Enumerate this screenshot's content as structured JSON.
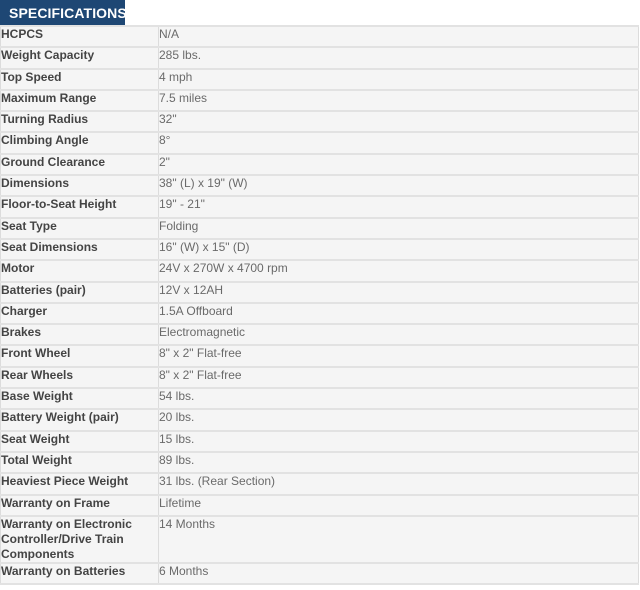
{
  "header": {
    "title": "SPECIFICATIONS"
  },
  "specs": [
    {
      "label": "HCPCS",
      "value": "N/A"
    },
    {
      "label": "Weight Capacity",
      "value": "285 lbs."
    },
    {
      "label": "Top Speed",
      "value": "4 mph"
    },
    {
      "label": "Maximum Range",
      "value": "7.5 miles"
    },
    {
      "label": "Turning Radius",
      "value": "32\""
    },
    {
      "label": "Climbing Angle",
      "value": "8°"
    },
    {
      "label": "Ground Clearance",
      "value": "2\""
    },
    {
      "label": "Dimensions",
      "value": "38\" (L) x 19\" (W)"
    },
    {
      "label": "Floor-to-Seat Height",
      "value": "19\" - 21\""
    },
    {
      "label": "Seat Type",
      "value": "Folding"
    },
    {
      "label": "Seat Dimensions",
      "value": "16\" (W) x 15\" (D)"
    },
    {
      "label": "Motor",
      "value": "24V x 270W x 4700 rpm"
    },
    {
      "label": "Batteries (pair)",
      "value": "12V x 12AH"
    },
    {
      "label": "Charger",
      "value": "1.5A Offboard"
    },
    {
      "label": "Brakes",
      "value": "Electromagnetic"
    },
    {
      "label": "Front Wheel",
      "value": "8\" x 2\" Flat-free"
    },
    {
      "label": "Rear Wheels",
      "value": "8\" x 2\" Flat-free"
    },
    {
      "label": "Base Weight",
      "value": "54 lbs."
    },
    {
      "label": "Battery Weight (pair)",
      "value": "20 lbs."
    },
    {
      "label": "Seat Weight",
      "value": "15 lbs."
    },
    {
      "label": "Total Weight",
      "value": "89 lbs."
    },
    {
      "label": "Heaviest Piece Weight",
      "value": "31 lbs. (Rear Section)"
    },
    {
      "label": "Warranty on Frame",
      "value": "Lifetime"
    },
    {
      "label": "Warranty on Electronic Controller/Drive Train Components",
      "value": "14 Months"
    },
    {
      "label": "Warranty on Batteries",
      "value": "6 Months"
    }
  ]
}
